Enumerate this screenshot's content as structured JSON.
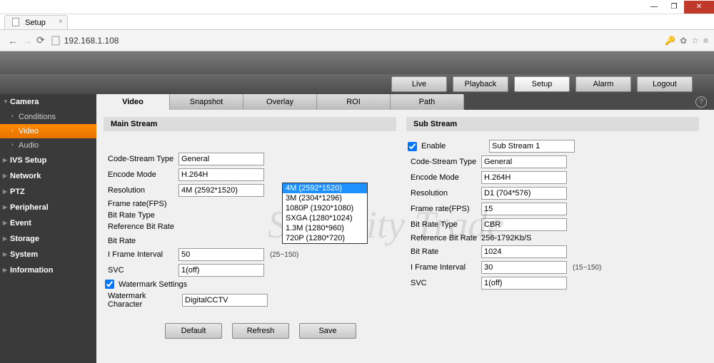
{
  "browser": {
    "tab_title": "Setup",
    "url": "192.168.1.108"
  },
  "mainnav": {
    "live": "Live",
    "playback": "Playback",
    "setup": "Setup",
    "alarm": "Alarm",
    "logout": "Logout"
  },
  "sidebar": {
    "camera": "Camera",
    "conditions": "Conditions",
    "video": "Video",
    "audio": "Audio",
    "ivs": "IVS Setup",
    "network": "Network",
    "ptz": "PTZ",
    "peripheral": "Peripheral",
    "event": "Event",
    "storage": "Storage",
    "system": "System",
    "information": "Information"
  },
  "subtabs": {
    "video": "Video",
    "snapshot": "Snapshot",
    "overlay": "Overlay",
    "roi": "ROI",
    "path": "Path"
  },
  "main_stream": {
    "title": "Main Stream",
    "code_stream_label": "Code-Stream Type",
    "code_stream_value": "General",
    "encode_label": "Encode Mode",
    "encode_value": "H.264H",
    "resolution_label": "Resolution",
    "resolution_value": "4M (2592*1520)",
    "fps_label": "Frame rate(FPS)",
    "bitratetype_label": "Bit Rate Type",
    "refbitrate_label": "Reference Bit Rate",
    "bitrate_label": "Bit Rate",
    "iframe_label": "I Frame Interval",
    "iframe_value": "50",
    "iframe_hint": "(25~150)",
    "svc_label": "SVC",
    "svc_value": "1(off)",
    "wm_label": "Watermark Settings",
    "wmchar_label": "Watermark Character",
    "wmchar_value": "DigitalCCTV"
  },
  "resolution_options": {
    "o0": "4M (2592*1520)",
    "o1": "3M (2304*1296)",
    "o2": "1080P (1920*1080)",
    "o3": "SXGA (1280*1024)",
    "o4": "1.3M (1280*960)",
    "o5": "720P (1280*720)"
  },
  "sub_stream": {
    "title": "Sub Stream",
    "enable_label": "Enable",
    "enable_value": "Sub Stream 1",
    "code_stream_value": "General",
    "encode_value": "H.264H",
    "resolution_value": "D1 (704*576)",
    "fps_value": "15",
    "bitratetype_value": "CBR",
    "refbitrate_value": "256-1792Kb/S",
    "bitrate_value": "1024",
    "iframe_value": "30",
    "iframe_hint": "(15~150)",
    "svc_value": "1(off)"
  },
  "actions": {
    "default": "Default",
    "refresh": "Refresh",
    "save": "Save"
  },
  "watermark_text": "Sincerity Trade"
}
